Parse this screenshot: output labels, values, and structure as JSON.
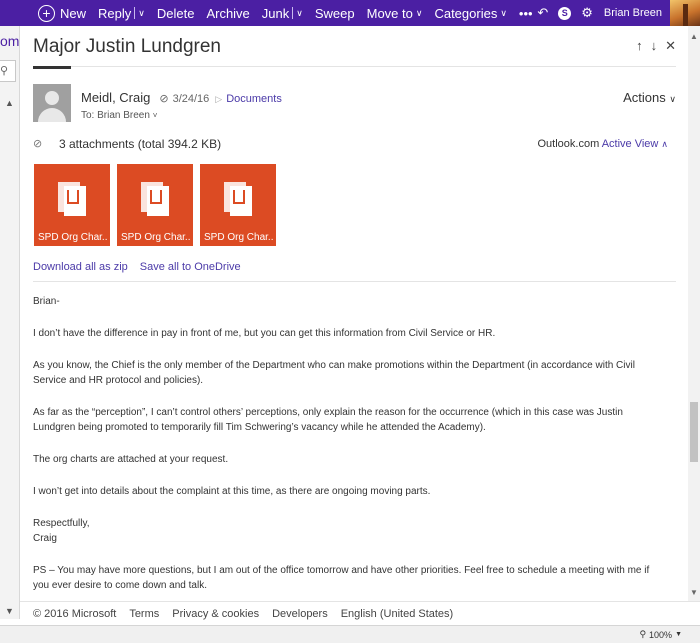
{
  "toolbar": {
    "new_label": "New",
    "reply_label": "Reply",
    "delete_label": "Delete",
    "archive_label": "Archive",
    "junk_label": "Junk",
    "sweep_label": "Sweep",
    "move_to_label": "Move to",
    "categories_label": "Categories",
    "more_label": "•••",
    "user_name": "Brian Breen"
  },
  "left_edge": {
    "brand_fragment": "om"
  },
  "message": {
    "subject": "Major Justin Lundgren",
    "sender": "Meidl, Craig",
    "date": "3/24/16",
    "folder": "Documents",
    "to_line": "To: Brian Breen",
    "actions_label": "Actions"
  },
  "attachments": {
    "summary": "3 attachments (total 394.2 KB)",
    "view_prefix": "Outlook.com",
    "view_active": "Active View",
    "items": [
      {
        "name": "SPD Org Char..."
      },
      {
        "name": "SPD Org Char..."
      },
      {
        "name": "SPD Org Char..."
      }
    ],
    "download_all_label": "Download all as zip",
    "save_onedrive_label": "Save all to OneDrive"
  },
  "body": {
    "p1": "Brian-",
    "p2": "I don’t have the difference in pay in front of me, but you can get this information from Civil Service or HR.",
    "p3": "As you know, the Chief is the only member of the Department who can make promotions within the Department (in accordance with Civil Service and HR protocol and policies).",
    "p4": "As far as the “perception”, I can’t control others’ perceptions, only explain the reason for the occurrence (which in this case was Justin Lundgren being promoted to temporarily fill Tim Schwering’s vacancy while he attended the Academy).",
    "p5": "The org charts are attached at your request.",
    "p6": "I won’t get into details about the complaint at this time, as there are ongoing moving parts.",
    "closing": "Respectfully,",
    "signature": "Craig",
    "ps": "PS – You may have more questions, but I am out of the office tomorrow and have other priorities.  Feel free to schedule a meeting with me if you ever desire to come down and talk."
  },
  "footer": {
    "copyright": "© 2016 Microsoft",
    "terms": "Terms",
    "privacy": "Privacy & cookies",
    "developers": "Developers",
    "language": "English (United States)"
  },
  "status": {
    "zoom": "100%"
  },
  "colors": {
    "topbar": "#4b1fa3",
    "link": "#4b3aa8",
    "attachment_tile": "#dc4b23"
  }
}
